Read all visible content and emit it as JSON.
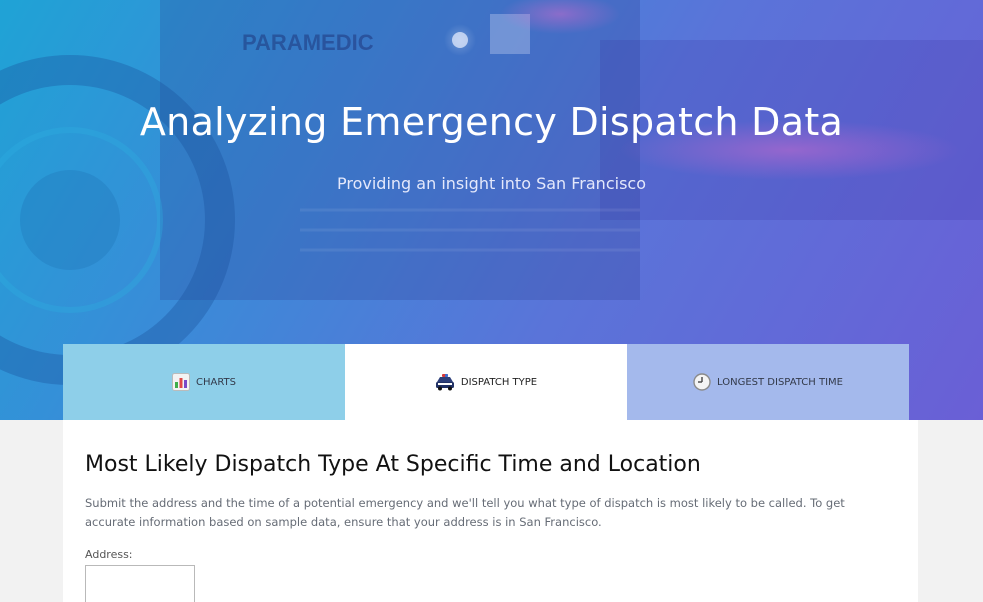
{
  "hero": {
    "title": "Analyzing Emergency Dispatch Data",
    "subtitle": "Providing an insight into San Francisco",
    "photo_text": "PARAMEDIC"
  },
  "tabs": [
    {
      "label": "CHARTS",
      "icon": "bar-chart-icon",
      "active": false
    },
    {
      "label": "DISPATCH TYPE",
      "icon": "police-car-icon",
      "active": true
    },
    {
      "label": "LONGEST DISPATCH TIME",
      "icon": "clock-icon",
      "active": false
    }
  ],
  "main": {
    "title": "Most Likely Dispatch Type At Specific Time and Location",
    "description": "Submit the address and the time of a potential emergency and we'll tell you what type of dispatch is most likely to be called. To get accurate information based on sample data, ensure that your address is in San Francisco.",
    "address_label": "Address:",
    "address_value": ""
  },
  "colors": {
    "hero_start": "#1fa3d6",
    "hero_end": "#6a5fd6",
    "tab_charts": "#8ecfe9",
    "tab_active": "#ffffff",
    "tab_longest": "#a4b9ec"
  }
}
